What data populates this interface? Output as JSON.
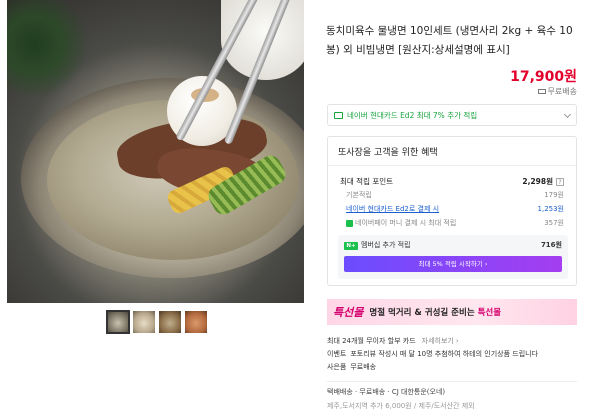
{
  "product": {
    "title": "동치미육수 물냉면 10인세트 (냉면사리 2kg + 육수 10봉) 외 비빔냉면 [원산지:상세설명에 표시]",
    "price": "17,900원",
    "shipping": "무료배송",
    "thumbnails": [
      "thumb-1",
      "thumb-2",
      "thumb-3",
      "thumb-4"
    ]
  },
  "card_banner": {
    "text": "네이버 현대카드 Ed2 최대 7% 추가 적립"
  },
  "benefit": {
    "heading": "또사장을 고객을 위한 혜택",
    "max_points_label": "최대 적립 포인트",
    "max_points_value": "2,298원",
    "qm": "?",
    "rows": [
      {
        "label": "기본적립",
        "value": "179원"
      },
      {
        "label": "네이버 현대카드 Ed2로 결제 시",
        "value": "1,253원"
      },
      {
        "label": "네이버페이 머니 결제 시 최대 적립",
        "value": "357원"
      }
    ],
    "membership": {
      "badge": "N+",
      "label": "멤버십 추가 적립",
      "value": "716원",
      "button": "최대 5% 적립 시작하기 ›"
    }
  },
  "promo": {
    "logo": "특선몰",
    "text_prefix": "명절 먹거리 & 귀성길 준비는 ",
    "text_highlight": "특선몰"
  },
  "info": {
    "installment": "최대 24개월 무이자 할부 카드",
    "installment_more": "자세히보기",
    "event_key": "이벤트",
    "event_text": "포토리뷰 작성시 매 달 10명 추첨하여 하테의 인기상품 드립니다",
    "gift_key": "사은품",
    "gift_text": "무료배송"
  },
  "delivery": {
    "line1": "택배배송  ·  무료배송  ·  CJ 대한통운(오네)",
    "line2": "제주,도서지역 추가 6,000원 / 제주/도서산간 제외"
  },
  "colors": {
    "price_red": "#e3002b",
    "naver_green": "#15a33c",
    "promo_pink": "#d4006f",
    "member_btn_start": "#6b4dff",
    "member_btn_end": "#a43ef0"
  }
}
